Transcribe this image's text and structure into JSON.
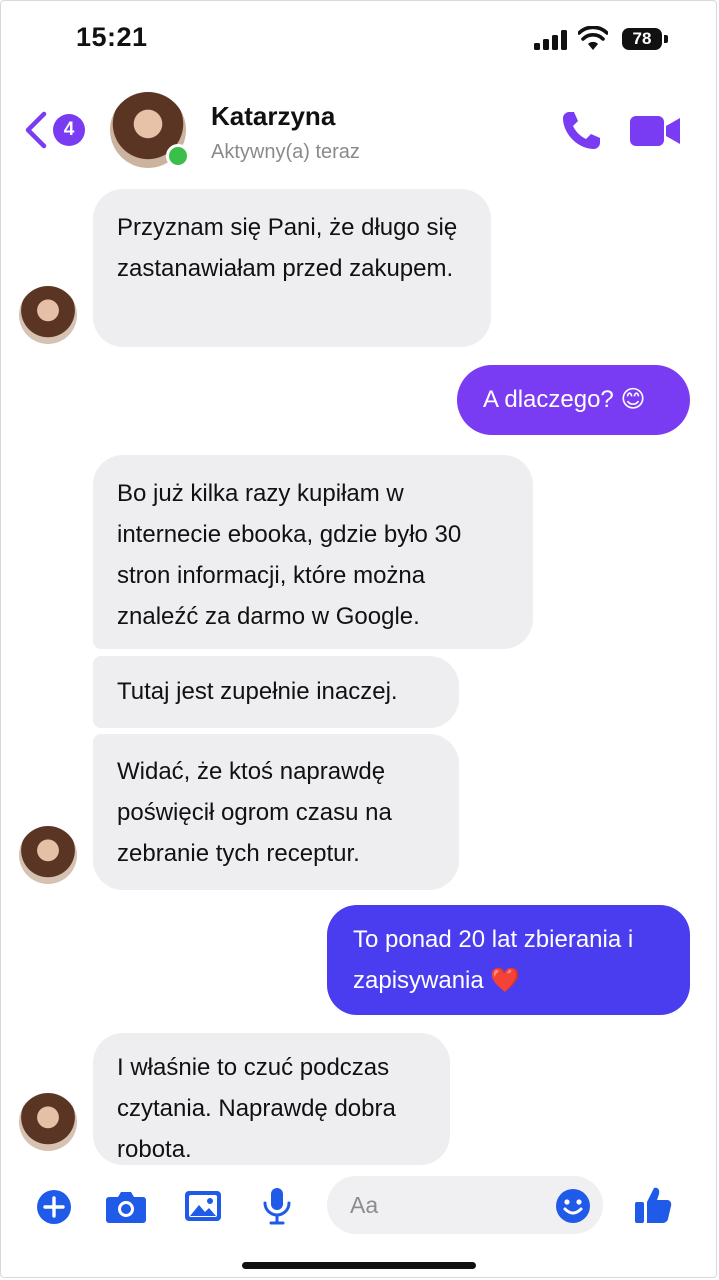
{
  "status_bar": {
    "time": "15:21",
    "battery": "78"
  },
  "header": {
    "unread_count": "4",
    "contact_name": "Katarzyna",
    "contact_status": "Aktywny(a) teraz"
  },
  "messages": [
    {
      "side": "in",
      "text": "Przyznam się Pani, że długo się zastanawiałam przed zakupem."
    },
    {
      "side": "out",
      "text": "A dlaczego? 😊"
    },
    {
      "side": "in",
      "text": "Bo już kilka razy kupiłam w internecie ebooka, gdzie było 30 stron informacji, które można znaleźć za darmo w Google."
    },
    {
      "side": "in",
      "text": "Tutaj jest zupełnie inaczej."
    },
    {
      "side": "in",
      "text": "Widać, że ktoś naprawdę poświęcił ogrom czasu na zebranie tych receptur."
    },
    {
      "side": "out",
      "text": "To ponad 20 lat zbierania i zapisywania ❤️"
    },
    {
      "side": "in",
      "text": "I właśnie to czuć podczas czytania. Naprawdę dobra robota."
    }
  ],
  "composer": {
    "placeholder": "Aa"
  },
  "colors": {
    "accent": "#7a3cf2",
    "composer_blue": "#1f5ae8",
    "incoming_bubble": "#eeeef0"
  }
}
